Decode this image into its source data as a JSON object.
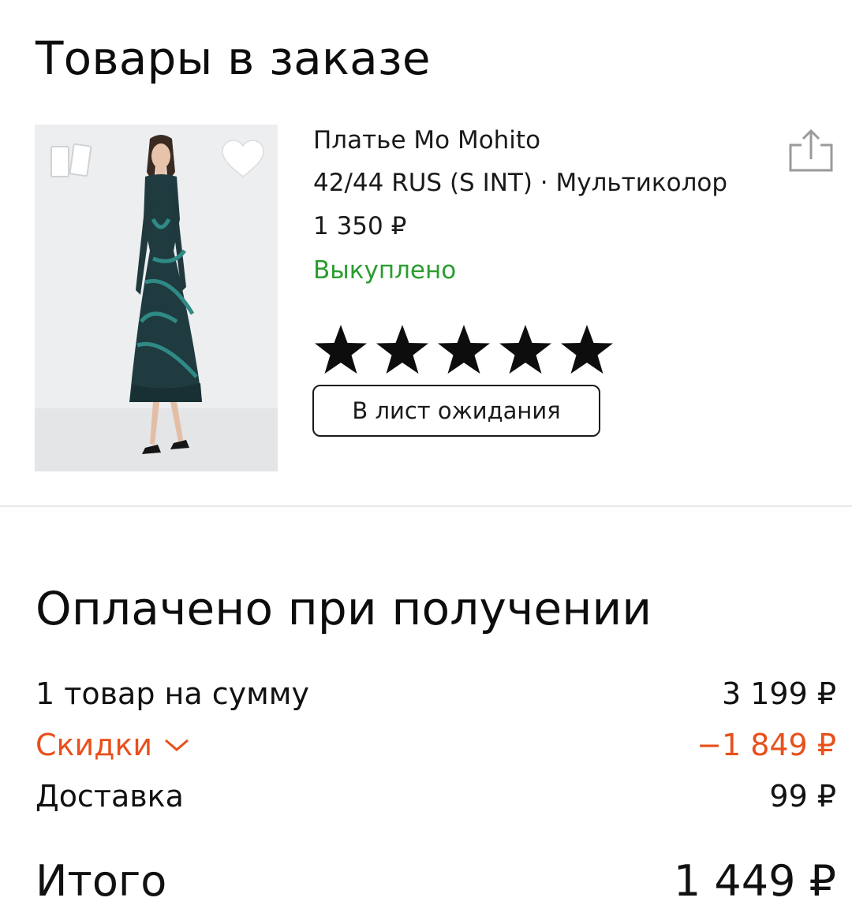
{
  "header": {
    "title": "Товары в заказе"
  },
  "product": {
    "name": "Платье Mo Mohito",
    "variant": "42/44 RUS (S INT) · Мультиколор",
    "price": "1 350 ₽",
    "status": "Выкуплено",
    "rating_stars": 5,
    "waitlist_label": "В лист ожидания"
  },
  "payment": {
    "title": "Оплачено при получении",
    "subtotal_label": "1 товар на сумму",
    "subtotal_value": "3 199 ₽",
    "discount_label": "Скидки",
    "discount_value": "−1 849 ₽",
    "delivery_label": "Доставка",
    "delivery_value": "99 ₽",
    "total_label": "Итого",
    "total_value": "1 449 ₽"
  },
  "colors": {
    "status_green": "#2a9d2f",
    "discount_orange": "#e8501c",
    "text": "#111111"
  },
  "icons": [
    "compare-icon",
    "heart-icon",
    "share-icon",
    "star-icon",
    "chevron-down-icon"
  ]
}
